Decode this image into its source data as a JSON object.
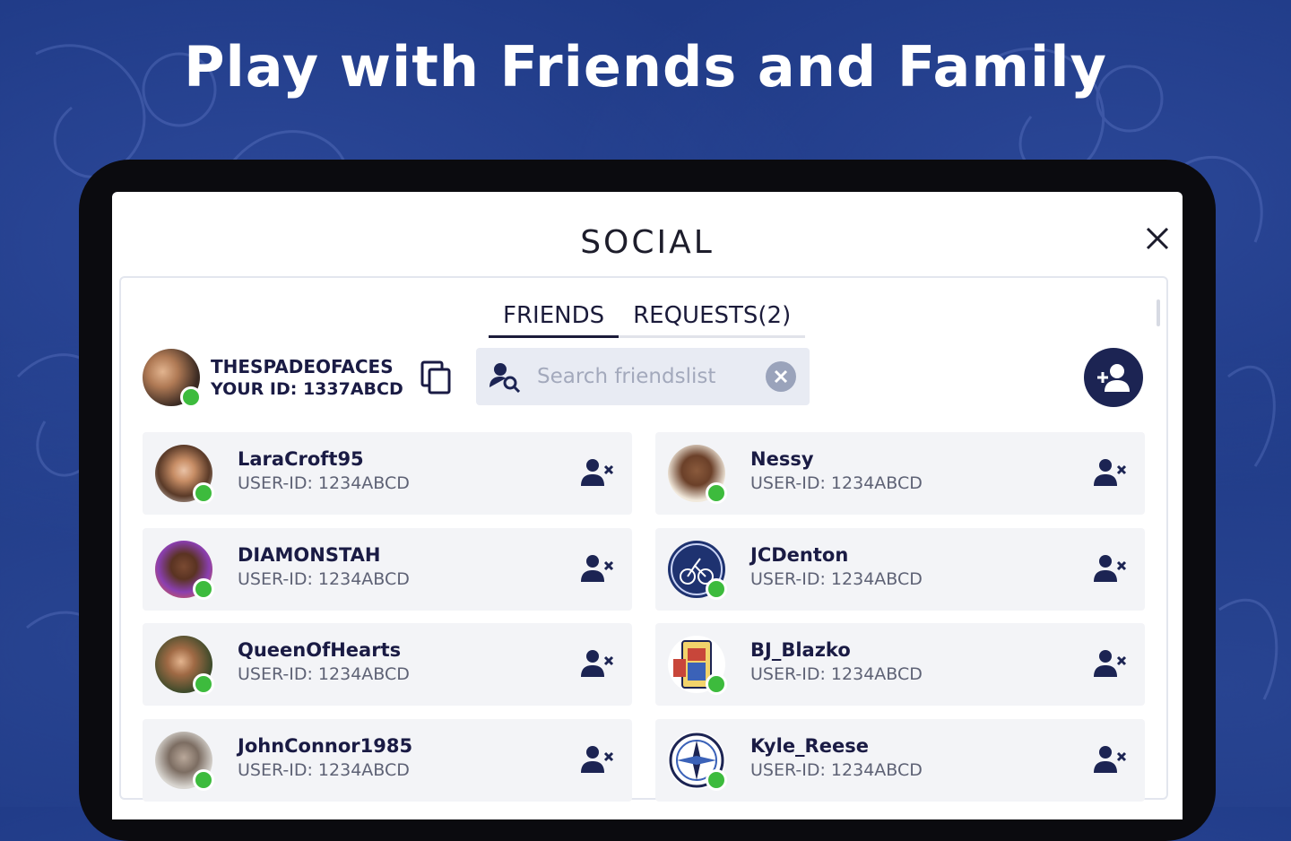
{
  "headline": "Play with Friends and Family",
  "dialog": {
    "title": "SOCIAL",
    "close_icon": "close-icon"
  },
  "tabs": [
    {
      "label": "FRIENDS",
      "active": true
    },
    {
      "label": "REQUESTS(2)",
      "active": false
    }
  ],
  "me": {
    "name": "THESPADEOFACES",
    "id_label": "YOUR ID: 1337ABCD",
    "status_color": "#3dbb3d"
  },
  "search": {
    "placeholder": "Search friendslist",
    "value": ""
  },
  "friends": [
    {
      "name": "LaraCroft95",
      "user_id": "USER-ID: 1234ABCD"
    },
    {
      "name": "Nessy",
      "user_id": "USER-ID: 1234ABCD"
    },
    {
      "name": "DIAMONSTAH",
      "user_id": "USER-ID: 1234ABCD"
    },
    {
      "name": "JCDenton",
      "user_id": "USER-ID: 1234ABCD"
    },
    {
      "name": "QueenOfHearts",
      "user_id": "USER-ID: 1234ABCD"
    },
    {
      "name": "BJ_Blazko",
      "user_id": "USER-ID: 1234ABCD"
    },
    {
      "name": "JohnConnor1985",
      "user_id": "USER-ID: 1234ABCD"
    },
    {
      "name": "Kyle_Reese",
      "user_id": "USER-ID: 1234ABCD"
    }
  ],
  "colors": {
    "accent": "#1c2453",
    "background": "#1f3a86",
    "online": "#3dbb3d"
  }
}
